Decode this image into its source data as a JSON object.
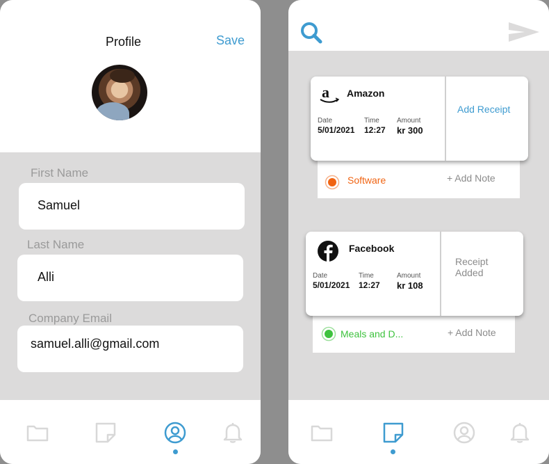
{
  "profile": {
    "title": "Profile",
    "save_label": "Save",
    "fields": {
      "first_name": {
        "label": "First Name",
        "value": "Samuel"
      },
      "last_name": {
        "label": "Last Name",
        "value": "Alli"
      },
      "company_email": {
        "label": "Company Email",
        "value": "samuel.alli@gmail.com"
      }
    }
  },
  "left_nav": {
    "items": [
      "folder-icon",
      "note-icon",
      "profile-icon",
      "bell-icon"
    ],
    "active": "profile-icon"
  },
  "receipts": [
    {
      "brand": "Amazon",
      "date_label": "Date",
      "date": "5/01/2021",
      "time_label": "Time",
      "time": "12:27",
      "amount_label": "Amount",
      "amount": "kr 300",
      "side": "Add Receipt",
      "category": "Software",
      "category_color": "#f06413",
      "add_note": "+ Add Note"
    },
    {
      "brand": "Facebook",
      "date_label": "Date",
      "date": "5/01/2021",
      "time_label": "Time",
      "time": "12:27",
      "amount_label": "Amount",
      "amount": "kr 108",
      "side": "Receipt Added",
      "category": "Meals and D...",
      "category_color": "#3ec23e",
      "add_note": "+ Add Note"
    }
  ],
  "right_nav": {
    "items": [
      "folder-icon",
      "note-icon",
      "profile-icon",
      "bell-icon"
    ],
    "active": "note-icon"
  },
  "colors": {
    "accent": "#3e9bd0",
    "background": "#dcdbdb",
    "icon_inactive": "#d8d8d8"
  }
}
